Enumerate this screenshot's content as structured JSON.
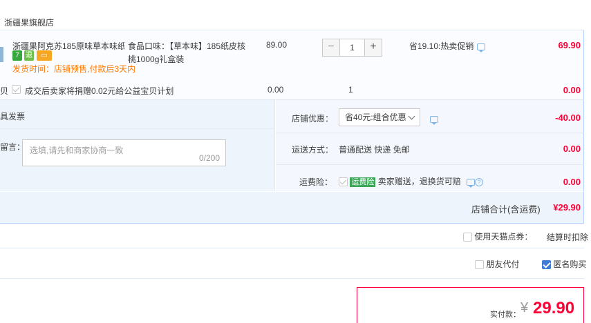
{
  "store": {
    "name": "浙疆果旗舰店"
  },
  "item": {
    "title": "浙疆果阿克苏185原味草本味纸...",
    "badges": [
      "7",
      "退",
      "▭"
    ],
    "ship_time": "发货时间：店铺预售,付款后3天内",
    "spec_line1": "食品口味：【草本味】185纸皮核",
    "spec_line2": "桃1000g礼盒装",
    "unit_price": "89.00",
    "quantity": "1",
    "qty_minus": "−",
    "qty_plus": "+",
    "promo": "省19.10:热卖促销",
    "subtotal": "69.90"
  },
  "charity": {
    "row_left": "贝",
    "label": "成交后卖家将捐赠0.02元给公益宝贝计划",
    "price": "0.00",
    "quantity": "1",
    "subtotal": "0.00"
  },
  "left_panel": {
    "invoice_label": "具发票",
    "message_label": "留言：",
    "message_placeholder": "选填,请先和商家协商一致",
    "message_count": "0/200"
  },
  "right_panel": {
    "discount_label": "店铺优惠：",
    "discount_option": "省40元:组合优惠",
    "discount_amount": "-40.00",
    "shipping_label": "运送方式：",
    "shipping_value": "普通配送 快递 免邮",
    "shipping_amount": "0.00",
    "insurance_label": "运费险：",
    "insurance_tag": "运费险",
    "insurance_text": "卖家赠送，退换货可赔",
    "insurance_amount": "0.00"
  },
  "totals": {
    "store_total_label": "店铺合计(含运费)",
    "store_total_value": "¥29.90",
    "tmall_points_label": "使用天猫点券：",
    "settle_note": "结算时扣除",
    "friend_pay_label": "朋友代付",
    "anonymous_label": "匿名购买",
    "actual_pay_label": "实付款：",
    "currency": "¥",
    "actual_pay_value": "29.90"
  },
  "colors": {
    "accent_red": "#ff0036",
    "link_blue": "#3d7bd5",
    "warn_orange": "#ff7a00"
  }
}
